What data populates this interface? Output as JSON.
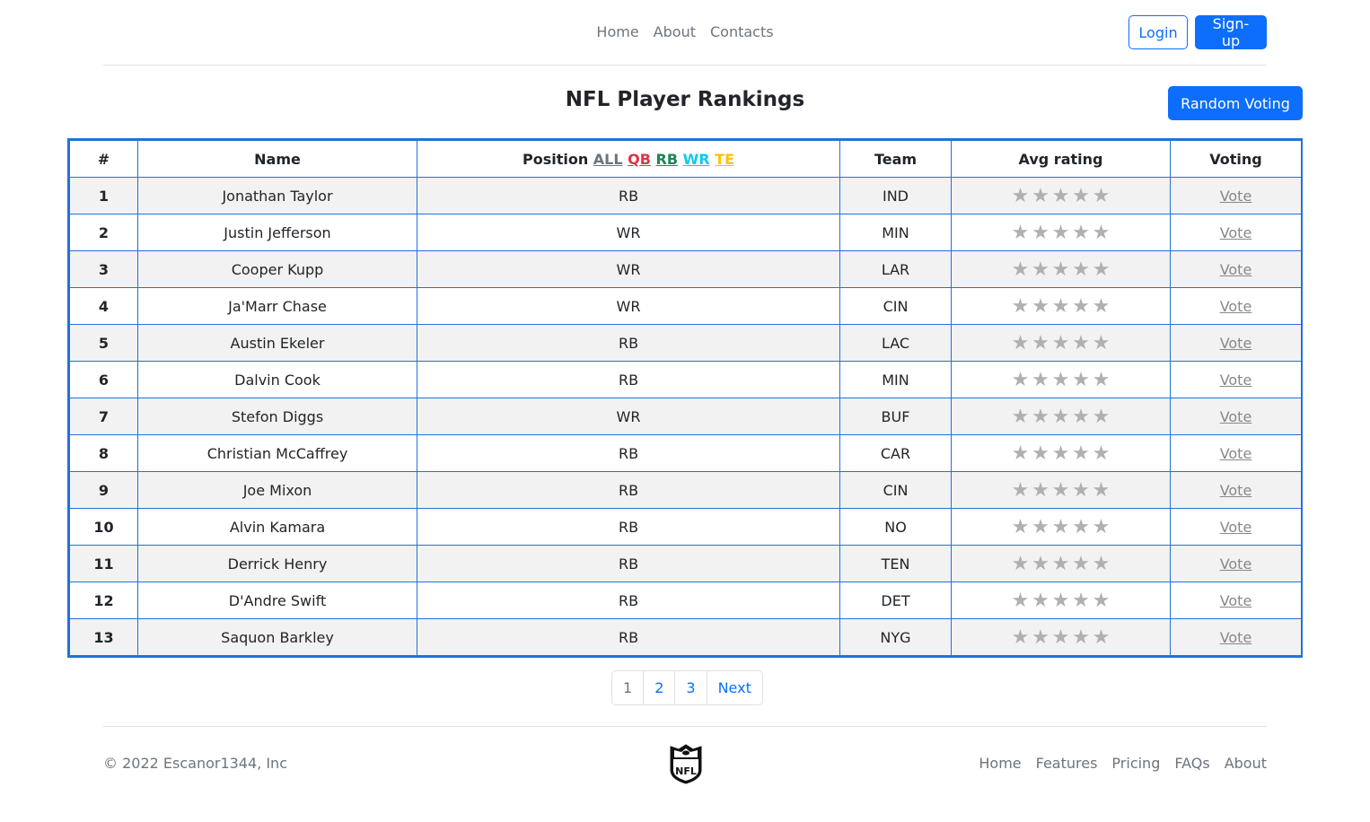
{
  "header": {
    "nav": [
      "Home",
      "About",
      "Contacts"
    ],
    "login_label": "Login",
    "signup_label": "Sign-up"
  },
  "title": "NFL Player Rankings",
  "random_voting_label": "Random Voting",
  "table": {
    "columns": {
      "rank": "#",
      "name": "Name",
      "position": "Position",
      "team": "Team",
      "avg_rating": "Avg rating",
      "voting": "Voting"
    },
    "position_filters": {
      "all": "ALL",
      "qb": "QB",
      "rb": "RB",
      "wr": "WR",
      "te": "TE"
    },
    "filter_colors": {
      "all": "#6c757d",
      "qb": "#dc3545",
      "rb": "#198754",
      "wr": "#0dcaf0",
      "te": "#ffc107"
    },
    "vote_label": "Vote",
    "rows": [
      {
        "rank": "1",
        "name": "Jonathan Taylor",
        "position": "RB",
        "team": "IND",
        "rating": 0
      },
      {
        "rank": "2",
        "name": "Justin Jefferson",
        "position": "WR",
        "team": "MIN",
        "rating": 0
      },
      {
        "rank": "3",
        "name": "Cooper Kupp",
        "position": "WR",
        "team": "LAR",
        "rating": 0
      },
      {
        "rank": "4",
        "name": "Ja'Marr Chase",
        "position": "WR",
        "team": "CIN",
        "rating": 0
      },
      {
        "rank": "5",
        "name": "Austin Ekeler",
        "position": "RB",
        "team": "LAC",
        "rating": 0
      },
      {
        "rank": "6",
        "name": "Dalvin Cook",
        "position": "RB",
        "team": "MIN",
        "rating": 0
      },
      {
        "rank": "7",
        "name": "Stefon Diggs",
        "position": "WR",
        "team": "BUF",
        "rating": 0
      },
      {
        "rank": "8",
        "name": "Christian McCaffrey",
        "position": "RB",
        "team": "CAR",
        "rating": 0
      },
      {
        "rank": "9",
        "name": "Joe Mixon",
        "position": "RB",
        "team": "CIN",
        "rating": 0
      },
      {
        "rank": "10",
        "name": "Alvin Kamara",
        "position": "RB",
        "team": "NO",
        "rating": 0
      },
      {
        "rank": "11",
        "name": "Derrick Henry",
        "position": "RB",
        "team": "TEN",
        "rating": 0
      },
      {
        "rank": "12",
        "name": "D'Andre Swift",
        "position": "RB",
        "team": "DET",
        "rating": 0
      },
      {
        "rank": "13",
        "name": "Saquon Barkley",
        "position": "RB",
        "team": "NYG",
        "rating": 0
      }
    ]
  },
  "pagination": {
    "pages": [
      "1",
      "2",
      "3"
    ],
    "next_label": "Next",
    "current": "1"
  },
  "footer": {
    "copyright": "© 2022 Escanor1344, Inc",
    "logo_icon": "nfl-shield-logo",
    "logo_text": "NFL",
    "nav": [
      "Home",
      "Features",
      "Pricing",
      "FAQs",
      "About"
    ]
  }
}
